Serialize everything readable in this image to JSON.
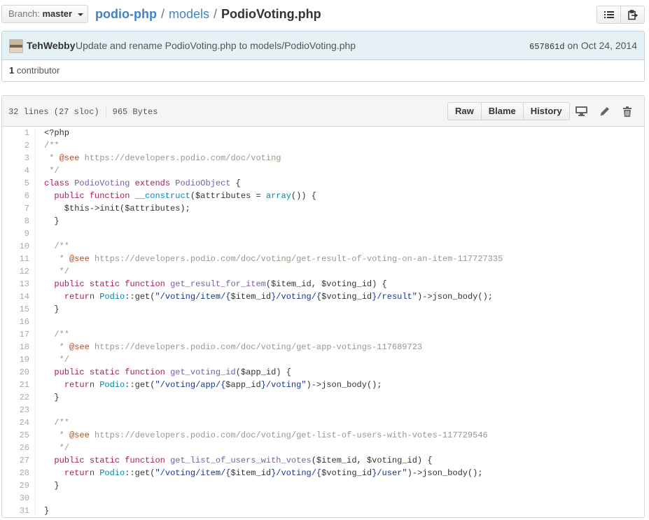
{
  "topbar": {
    "branch_prefix": "Branch:",
    "branch_name": "master",
    "repo": "podio-php",
    "dir": "models",
    "separator": "/",
    "file": "PodioVoting.php",
    "icons": [
      "list-icon",
      "clipboard-icon"
    ]
  },
  "commit": {
    "author": "TehWebby",
    "message": "Update and rename PodioVoting.php to models/PodioVoting.php",
    "sha": "657861d",
    "date": "on Oct 24, 2014",
    "contributor_count": "1",
    "contributor_label": "contributor"
  },
  "file": {
    "lines_info": "32 lines (27 sloc)",
    "size": "965 Bytes",
    "buttons": {
      "raw": "Raw",
      "blame": "Blame",
      "history": "History"
    },
    "action_icons": [
      "desktop-icon",
      "pencil-icon",
      "trash-icon"
    ]
  },
  "code": [
    {
      "n": "1",
      "t": [
        [
          "",
          "<?php"
        ]
      ]
    },
    {
      "n": "2",
      "t": [
        [
          "c",
          "/**"
        ]
      ]
    },
    {
      "n": "3",
      "t": [
        [
          "c",
          " * "
        ],
        [
          "d",
          "@see"
        ],
        [
          "c",
          " https://developers.podio.com/doc/voting"
        ]
      ]
    },
    {
      "n": "4",
      "t": [
        [
          "c",
          " */"
        ]
      ]
    },
    {
      "n": "5",
      "t": [
        [
          "k",
          "class"
        ],
        [
          "",
          " "
        ],
        [
          "n",
          "PodioVoting"
        ],
        [
          "",
          " "
        ],
        [
          "k",
          "extends"
        ],
        [
          "",
          " "
        ],
        [
          "n",
          "PodioObject"
        ],
        [
          "",
          " {"
        ]
      ]
    },
    {
      "n": "6",
      "t": [
        [
          "",
          "  "
        ],
        [
          "k",
          "public"
        ],
        [
          "",
          " "
        ],
        [
          "k",
          "function"
        ],
        [
          "",
          " "
        ],
        [
          "b",
          "__construct"
        ],
        [
          "",
          "($attributes = "
        ],
        [
          "b",
          "array"
        ],
        [
          "",
          "()) {"
        ]
      ]
    },
    {
      "n": "7",
      "t": [
        [
          "",
          "    $this->init($attributes);"
        ]
      ]
    },
    {
      "n": "8",
      "t": [
        [
          "",
          "  }"
        ]
      ]
    },
    {
      "n": "9",
      "t": [
        [
          "",
          ""
        ]
      ]
    },
    {
      "n": "10",
      "t": [
        [
          "c",
          "  /**"
        ]
      ]
    },
    {
      "n": "11",
      "t": [
        [
          "c",
          "   * "
        ],
        [
          "d",
          "@see"
        ],
        [
          "c",
          " https://developers.podio.com/doc/voting/get-result-of-voting-on-an-item-117727335"
        ]
      ]
    },
    {
      "n": "12",
      "t": [
        [
          "c",
          "   */"
        ]
      ]
    },
    {
      "n": "13",
      "t": [
        [
          "",
          "  "
        ],
        [
          "k",
          "public"
        ],
        [
          "",
          " "
        ],
        [
          "k",
          "static"
        ],
        [
          "",
          " "
        ],
        [
          "k",
          "function"
        ],
        [
          "",
          " "
        ],
        [
          "f",
          "get_result_for_item"
        ],
        [
          "",
          "($item_id, $voting_id) {"
        ]
      ]
    },
    {
      "n": "14",
      "t": [
        [
          "",
          "    "
        ],
        [
          "k",
          "return"
        ],
        [
          "",
          " "
        ],
        [
          "b",
          "Podio"
        ],
        [
          "",
          "::get("
        ],
        [
          "s",
          "\"/voting/item/{"
        ],
        [
          "",
          "$item_id"
        ],
        [
          "s",
          "}/voting/{"
        ],
        [
          "",
          "$voting_id"
        ],
        [
          "s",
          "}/result\""
        ],
        [
          "",
          ")->json_body();"
        ]
      ]
    },
    {
      "n": "15",
      "t": [
        [
          "",
          "  }"
        ]
      ]
    },
    {
      "n": "16",
      "t": [
        [
          "",
          ""
        ]
      ]
    },
    {
      "n": "17",
      "t": [
        [
          "c",
          "  /**"
        ]
      ]
    },
    {
      "n": "18",
      "t": [
        [
          "c",
          "   * "
        ],
        [
          "d",
          "@see"
        ],
        [
          "c",
          " https://developers.podio.com/doc/voting/get-app-votings-117689723"
        ]
      ]
    },
    {
      "n": "19",
      "t": [
        [
          "c",
          "   */"
        ]
      ]
    },
    {
      "n": "20",
      "t": [
        [
          "",
          "  "
        ],
        [
          "k",
          "public"
        ],
        [
          "",
          " "
        ],
        [
          "k",
          "static"
        ],
        [
          "",
          " "
        ],
        [
          "k",
          "function"
        ],
        [
          "",
          " "
        ],
        [
          "f",
          "get_voting_id"
        ],
        [
          "",
          "($app_id) {"
        ]
      ]
    },
    {
      "n": "21",
      "t": [
        [
          "",
          "    "
        ],
        [
          "k",
          "return"
        ],
        [
          "",
          " "
        ],
        [
          "b",
          "Podio"
        ],
        [
          "",
          "::get("
        ],
        [
          "s",
          "\"/voting/app/{"
        ],
        [
          "",
          "$app_id"
        ],
        [
          "s",
          "}/voting\""
        ],
        [
          "",
          ")->json_body();"
        ]
      ]
    },
    {
      "n": "22",
      "t": [
        [
          "",
          "  }"
        ]
      ]
    },
    {
      "n": "23",
      "t": [
        [
          "",
          ""
        ]
      ]
    },
    {
      "n": "24",
      "t": [
        [
          "c",
          "  /**"
        ]
      ]
    },
    {
      "n": "25",
      "t": [
        [
          "c",
          "   * "
        ],
        [
          "d",
          "@see"
        ],
        [
          "c",
          " https://developers.podio.com/doc/voting/get-list-of-users-with-votes-117729546"
        ]
      ]
    },
    {
      "n": "26",
      "t": [
        [
          "c",
          "   */"
        ]
      ]
    },
    {
      "n": "27",
      "t": [
        [
          "",
          "  "
        ],
        [
          "k",
          "public"
        ],
        [
          "",
          " "
        ],
        [
          "k",
          "static"
        ],
        [
          "",
          " "
        ],
        [
          "k",
          "function"
        ],
        [
          "",
          " "
        ],
        [
          "f",
          "get_list_of_users_with_votes"
        ],
        [
          "",
          "($item_id, $voting_id) {"
        ]
      ]
    },
    {
      "n": "28",
      "t": [
        [
          "",
          "    "
        ],
        [
          "k",
          "return"
        ],
        [
          "",
          " "
        ],
        [
          "b",
          "Podio"
        ],
        [
          "",
          "::get("
        ],
        [
          "s",
          "\"/voting/item/{"
        ],
        [
          "",
          "$item_id"
        ],
        [
          "s",
          "}/voting/{"
        ],
        [
          "",
          "$voting_id"
        ],
        [
          "s",
          "}/user\""
        ],
        [
          "",
          ")->json_body();"
        ]
      ]
    },
    {
      "n": "29",
      "t": [
        [
          "",
          "  }"
        ]
      ]
    },
    {
      "n": "30",
      "t": [
        [
          "",
          ""
        ]
      ]
    },
    {
      "n": "31",
      "t": [
        [
          "",
          "}"
        ]
      ]
    }
  ]
}
